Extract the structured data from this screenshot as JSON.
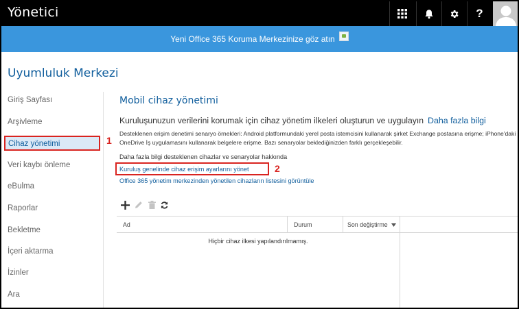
{
  "app": {
    "title": "Yönetici"
  },
  "topbar": {
    "buttons": [
      {
        "icon": "app-launcher-icon"
      },
      {
        "icon": "bell-icon"
      },
      {
        "icon": "gear-icon"
      },
      {
        "icon": "help-icon",
        "label": "?"
      }
    ],
    "avatar_icon": "user-avatar-icon"
  },
  "banner": {
    "text": "Yeni Office 365 Koruma Merkezinize göz atın",
    "color": "#3a96dd"
  },
  "page": {
    "title": "Uyumluluk Merkezi"
  },
  "nav": {
    "items": [
      {
        "label": "Giriş Sayfası"
      },
      {
        "label": "Arşivleme"
      },
      {
        "label": "Cihaz yönetimi",
        "active": true
      },
      {
        "label": "Veri kaybı önleme"
      },
      {
        "label": "eBulma"
      },
      {
        "label": "Raporlar"
      },
      {
        "label": "Bekletme"
      },
      {
        "label": "İçeri aktarma"
      },
      {
        "label": "İzinler"
      },
      {
        "label": "Ara"
      }
    ]
  },
  "markers": {
    "one": "1",
    "two": "2",
    "color": "#d9231f"
  },
  "main": {
    "section_title": "Mobil cihaz yönetimi",
    "headline": "Kuruluşunuzun verilerini korumak için cihaz yönetim ilkeleri oluşturun ve uygulayın",
    "learn_more": "Daha fazla bilgi",
    "description": "Desteklenen erişim denetimi senaryo örnekleri: Android platformundaki yerel posta istemcisini kullanarak şirket Exchange postasına erişme; iPhone'daki OneDrive İş uygulamasını kullanarak belgelere erişme. Bazı senaryolar beklediğinizden farklı gerçekleşebilir.",
    "links": {
      "supported_devices": "Daha fazla bilgi desteklenen cihazlar ve senaryolar hakkında",
      "manage_access": "Kuruluş genelinde cihaz erişim ayarlarını yönet",
      "device_list": "Office 365 yönetim merkezinden yönetilen cihazların listesini görüntüle"
    }
  },
  "toolbar": {
    "add": "+",
    "icons": [
      "plus-icon",
      "edit-icon",
      "delete-icon",
      "refresh-icon"
    ]
  },
  "table": {
    "columns": [
      "Ad",
      "Durum",
      "Son değiştirme"
    ],
    "empty_message": "Hiçbir cihaz ilkesi yapılandırılmamış."
  }
}
